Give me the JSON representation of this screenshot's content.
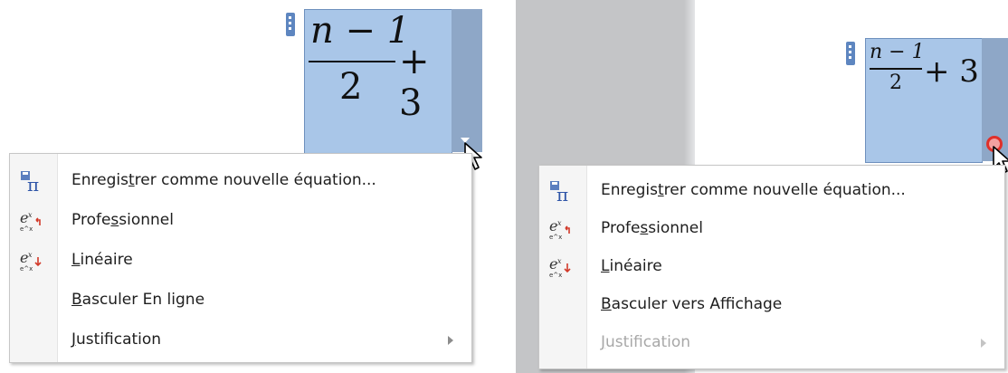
{
  "equation": {
    "numerator": "n − 1",
    "denominator": "2",
    "suffix": "+ 3"
  },
  "left_menu": {
    "items": [
      {
        "pre": "Enregis",
        "u": "t",
        "post": "rer comme nouvelle équation...",
        "icon": "save-equation-icon",
        "enabled": true
      },
      {
        "pre": "Profe",
        "u": "s",
        "post": "sionnel",
        "icon": "professional-format-icon",
        "enabled": true
      },
      {
        "pre": "",
        "u": "L",
        "post": "inéaire",
        "icon": "linear-format-icon",
        "enabled": true
      },
      {
        "pre": "",
        "u": "B",
        "post": "asculer En ligne",
        "icon": "",
        "enabled": true
      },
      {
        "pre": "",
        "u": "J",
        "post": "ustification",
        "icon": "",
        "enabled": true,
        "submenu": true
      }
    ]
  },
  "right_menu": {
    "items": [
      {
        "pre": "Enregis",
        "u": "t",
        "post": "rer comme nouvelle équation...",
        "icon": "save-equation-icon",
        "enabled": true
      },
      {
        "pre": "Profe",
        "u": "s",
        "post": "sionnel",
        "icon": "professional-format-icon",
        "enabled": true
      },
      {
        "pre": "",
        "u": "L",
        "post": "inéaire",
        "icon": "linear-format-icon",
        "enabled": true
      },
      {
        "pre": "",
        "u": "B",
        "post": "asculer vers Affichage",
        "icon": "",
        "enabled": true
      },
      {
        "pre": "",
        "u": "J",
        "post": "ustification",
        "icon": "",
        "enabled": false,
        "submenu": true
      }
    ]
  },
  "colors": {
    "equation_fill": "#a9c6e8",
    "handle": "#5e86c0",
    "busy_indicator": "#e0302a"
  }
}
